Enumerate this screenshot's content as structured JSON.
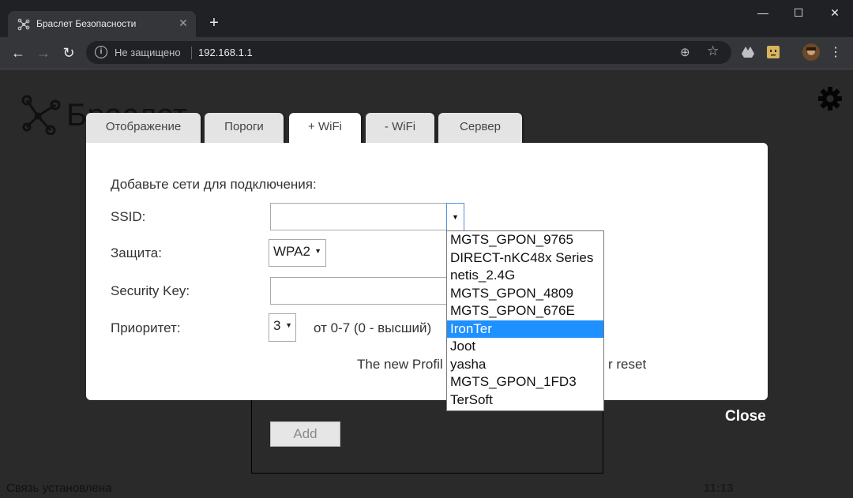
{
  "browser": {
    "tab_title": "Браслет Безопасности",
    "not_secure_label": "Не защищено",
    "url": "192.168.1.1"
  },
  "page": {
    "logo_text": "Браслет",
    "status_text": "Связь установлена",
    "clock": "11:13",
    "close_label": "Close"
  },
  "dialog": {
    "tabs": [
      "Отображение",
      "Пороги",
      "+ WiFi",
      "- WiFi",
      "Сервер"
    ],
    "active_tab": "+ WiFi",
    "heading": "Добавьте сети для подключения:",
    "ssid_label": "SSID:",
    "ssid_value": "",
    "security_label": "Защита:",
    "security_value": "WPA2",
    "key_label": "Security Key:",
    "key_value": "",
    "priority_label": "Приоритет:",
    "priority_value": "3",
    "priority_hint": "от 0-7 (0 - высший)",
    "add_button": "Add",
    "note_left": "The new Profil",
    "note_right": "r reset"
  },
  "ssid_dropdown": {
    "options": [
      "MGTS_GPON_9765",
      "DIRECT-nKC48x Series",
      "netis_2.4G",
      "MGTS_GPON_4809",
      "MGTS_GPON_676E",
      "IronTer",
      "Joot",
      "yasha",
      "MGTS_GPON_1FD3",
      "TerSoft"
    ],
    "highlighted": "IronTer"
  },
  "colors": {
    "chrome_dark": "#202124",
    "chrome_toolbar": "#35363a",
    "page_bg": "#2a2a2a",
    "highlight": "#1e90ff"
  }
}
